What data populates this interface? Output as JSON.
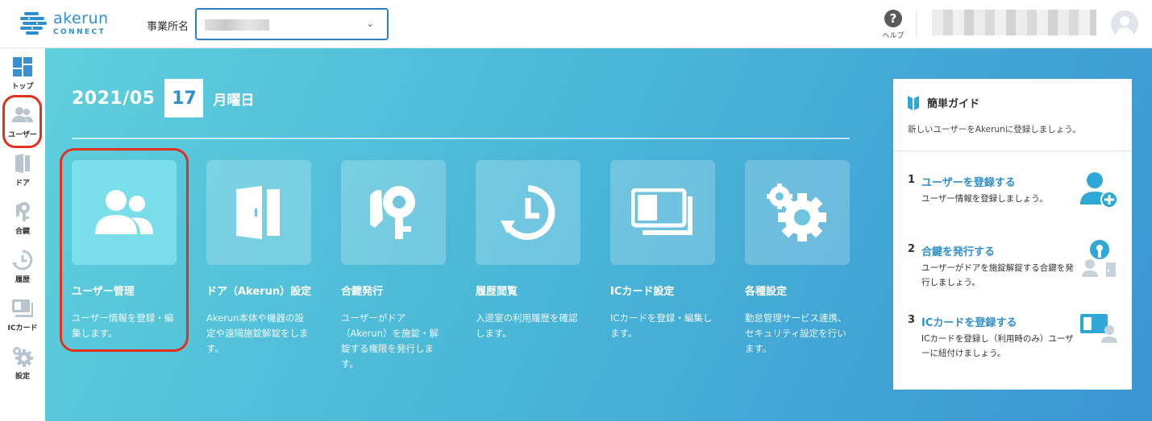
{
  "header": {
    "logo_name": "akerun",
    "logo_sub": "CONNECT",
    "office_label": "事業所名",
    "help_label": "ヘルプ"
  },
  "sidebar": {
    "items": [
      {
        "label": "トップ",
        "icon": "dashboard-icon"
      },
      {
        "label": "ユーザー",
        "icon": "users-icon"
      },
      {
        "label": "ドア",
        "icon": "door-icon"
      },
      {
        "label": "合鍵",
        "icon": "key-icon"
      },
      {
        "label": "履歴",
        "icon": "history-icon"
      },
      {
        "label": "ICカード",
        "icon": "ic-card-icon"
      },
      {
        "label": "設定",
        "icon": "gear-icon"
      }
    ]
  },
  "date": {
    "year_month": "2021/05",
    "day": "17",
    "weekday": "月曜日"
  },
  "cards": [
    {
      "title": "ユーザー管理",
      "desc": "ユーザー情報を登録・編集します。",
      "icon": "users-icon"
    },
    {
      "title": "ドア（Akerun）設定",
      "desc": "Akerun本体や機器の設定や遠隔施錠解錠をします。",
      "icon": "door-icon"
    },
    {
      "title": "合鍵発行",
      "desc": "ユーザーがドア（Akerun）を施錠・解錠する権限を発行します。",
      "icon": "key-icon"
    },
    {
      "title": "履歴閲覧",
      "desc": "入退室の利用履歴を確認します。",
      "icon": "history-icon"
    },
    {
      "title": "ICカード設定",
      "desc": "ICカードを登録・編集します。",
      "icon": "ic-card-icon"
    },
    {
      "title": "各種設定",
      "desc": "勤怠管理サービス連携、セキュリティ設定を行います。",
      "icon": "gear-icon"
    }
  ],
  "guide": {
    "title": "簡単ガイド",
    "subtitle": "新しいユーザーをAkerunに登録しましょう。",
    "steps": [
      {
        "num": "1",
        "title": "ユーザーを登録する",
        "desc": "ユーザー情報を登録しましょう。",
        "icon": "add-user-icon"
      },
      {
        "num": "2",
        "title": "合鍵を発行する",
        "desc": "ユーザーがドアを施錠解錠する合鍵を発行しましょう。",
        "icon": "key-user-icon"
      },
      {
        "num": "3",
        "title": "ICカードを登録する",
        "desc": "ICカードを登録し（利用時のみ）ユーザーに紐付けましょう。",
        "icon": "ic-card-user-icon"
      }
    ]
  },
  "colors": {
    "brand": "#2e8fd0",
    "highlight": "#e2301e",
    "main_gradient_start": "#5fcfdc",
    "main_gradient_end": "#3a95d2"
  }
}
